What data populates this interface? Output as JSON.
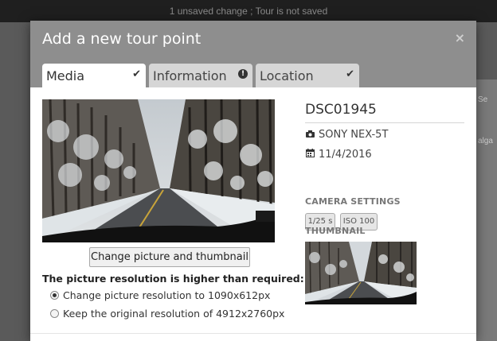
{
  "status_bar": {
    "text": "1 unsaved change ; Tour is not saved"
  },
  "background": {
    "map_fragments": [
      "Se",
      "alga"
    ]
  },
  "modal": {
    "title": "Add a new tour point",
    "close_label": "×",
    "tabs": [
      {
        "label": "Media",
        "icon": "check-icon",
        "glyph": "✔",
        "active": true
      },
      {
        "label": "Information",
        "icon": "alert-icon",
        "glyph": "!",
        "active": false
      },
      {
        "label": "Location",
        "icon": "check-icon",
        "glyph": "✔",
        "active": false
      }
    ]
  },
  "media": {
    "change_button_label": "Change picture and thumbnail",
    "resolution_title": "The picture resolution is higher than required:",
    "options": [
      {
        "label": "Change picture resolution to 1090x612px",
        "checked": true
      },
      {
        "label": "Keep the original resolution of 4912x2760px",
        "checked": false
      }
    ]
  },
  "details": {
    "name": "DSC01945",
    "camera": "SONY NEX-5T",
    "date": "11/4/2016",
    "camera_settings_label": "CAMERA SETTINGS",
    "settings": [
      "1/25 s",
      "ISO 100"
    ],
    "thumbnail_label": "THUMBNAIL"
  },
  "icons": {
    "camera": "camera-icon",
    "calendar": "calendar-icon"
  }
}
